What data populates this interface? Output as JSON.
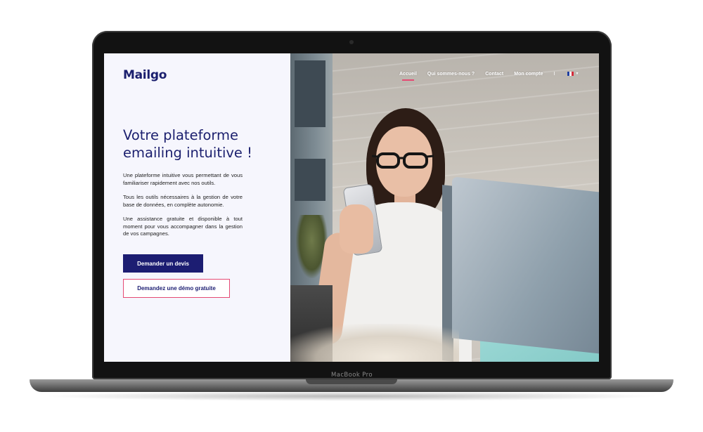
{
  "device": {
    "bezel_label": "MacBook Pro"
  },
  "site": {
    "logo": "Mailgo",
    "brand_colors": {
      "navy": "#1c1d72",
      "pink": "#e54a74"
    }
  },
  "nav": {
    "items": [
      {
        "label": "Accueil",
        "active": true
      },
      {
        "label": "Qui sommes-nous ?",
        "active": false
      },
      {
        "label": "Contact",
        "active": false
      },
      {
        "label": "Mon compte",
        "active": false
      }
    ],
    "separator": "I",
    "language_icon": "french-flag-icon"
  },
  "hero": {
    "title": "Votre plateforme emailing intuitive !",
    "paragraphs": [
      "Une plateforme intuitive vous permettant de vous familiariser rapidement avec nos outils.",
      "Tous les outils nécessaires à la gestion de votre base de données, en complète autonomie.",
      "Une assistance gratuite et disponible à tout moment pour vous accompagner dans la gestion de vos campagnes."
    ],
    "primary_button": "Demander un devis",
    "secondary_button": "Demandez une démo gratuite"
  }
}
